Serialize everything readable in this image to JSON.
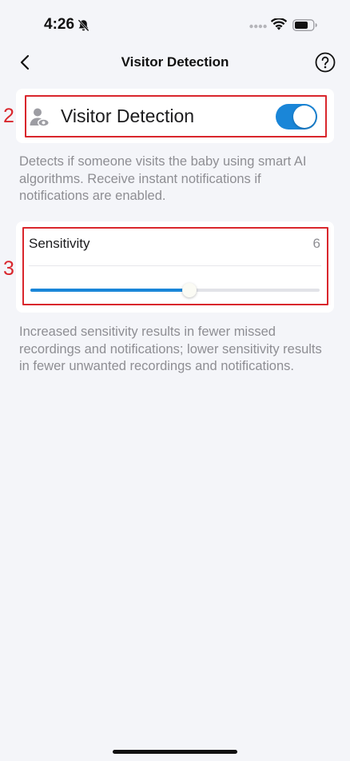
{
  "status_bar": {
    "time": "4:26",
    "icons": [
      "bell-slash-icon",
      "signal-dots-icon",
      "wifi-icon",
      "battery-icon"
    ]
  },
  "nav": {
    "title": "Visitor Detection",
    "back_icon": "chevron-left-icon",
    "help_icon": "help-icon"
  },
  "markers": {
    "toggle_marker": "2",
    "sensitivity_marker": "3"
  },
  "visitor_detection": {
    "icon": "person-eye-icon",
    "label": "Visitor Detection",
    "enabled": true,
    "description": "Detects if someone visits the baby using smart AI algorithms. Receive instant notifications if notifications are enabled."
  },
  "sensitivity": {
    "label": "Sensitivity",
    "value": "6",
    "level_fraction": 0.55,
    "description": "Increased sensitivity results in fewer missed recordings and notifications; lower sensitivity results in fewer unwanted recordings and notifications."
  },
  "colors": {
    "accent": "#1a86d8",
    "marker": "#d9262c",
    "background": "#f4f5f9"
  }
}
